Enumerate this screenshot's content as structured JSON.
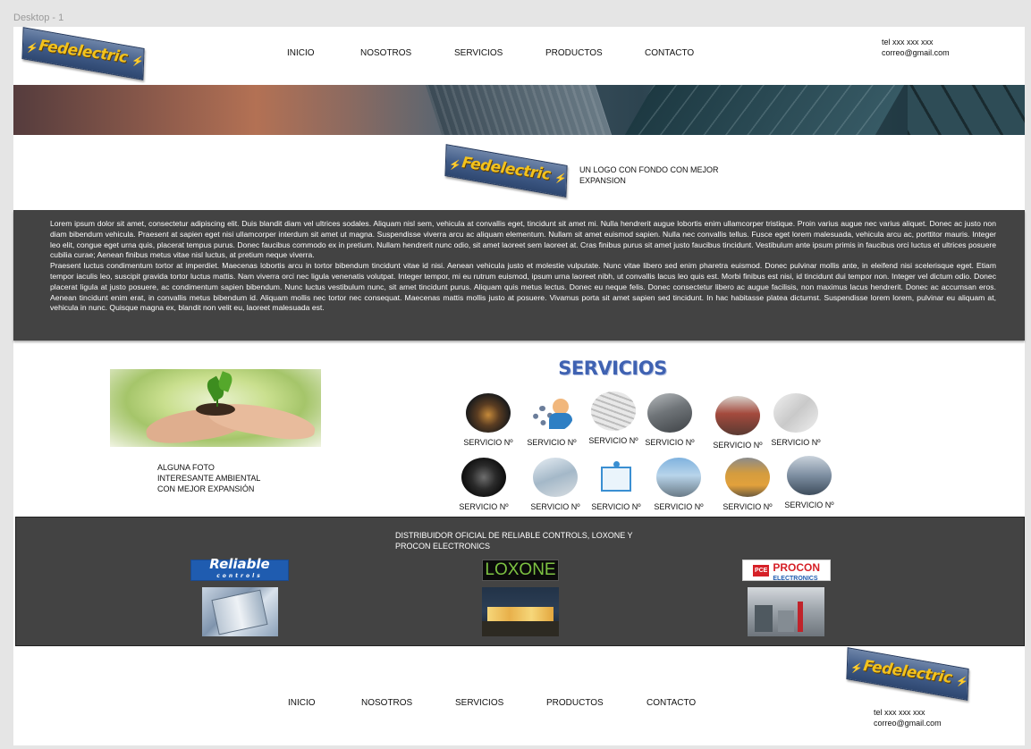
{
  "canvas": {
    "frame_label": "Desktop - 1"
  },
  "brand": {
    "logo_text": "Fedelectric"
  },
  "header": {
    "nav": [
      "INICIO",
      "NOSOTROS",
      "SERVICIOS",
      "PRODUCTOS",
      "CONTACTO"
    ],
    "phone": "tel xxx xxx xxx",
    "email": "correo@gmail.com"
  },
  "intro": {
    "tagline": "UN LOGO CON FONDO CON MEJOR EXPANSION"
  },
  "lorem": {
    "p1": "Lorem ipsum dolor sit amet, consectetur adipiscing elit. Duis blandit diam vel ultrices sodales. Aliquam nisl sem, vehicula at convallis eget, tincidunt sit amet mi. Nulla hendrerit augue lobortis enim ullamcorper tristique. Proin varius augue nec varius aliquet. Donec ac justo non diam bibendum vehicula. Praesent at sapien eget nisi ullamcorper interdum sit amet ut magna. Suspendisse viverra arcu ac aliquam elementum. Nullam sit amet euismod sapien. Nulla nec convallis tellus. Fusce eget lorem malesuada, vehicula arcu ac, porttitor mauris. Integer leo elit, congue eget urna quis, placerat tempus purus. Donec faucibus commodo ex in pretium. Nullam hendrerit nunc odio, sit amet laoreet sem laoreet at. Cras finibus purus sit amet justo faucibus tincidunt. Vestibulum ante ipsum primis in faucibus orci luctus et ultrices posuere cubilia curae; Aenean finibus metus vitae nisl luctus, at pretium neque viverra.",
    "p2": "Praesent luctus condimentum tortor at imperdiet. Maecenas lobortis arcu in tortor bibendum tincidunt vitae id nisi. Aenean vehicula justo et molestie vulputate. Nunc vitae libero sed enim pharetra euismod. Donec pulvinar mollis ante, in eleifend nisi scelerisque eget. Etiam tempor iaculis leo, suscipit gravida tortor luctus mattis. Nam viverra orci nec ligula venenatis volutpat. Integer tempor, mi eu rutrum euismod, ipsum urna laoreet nibh, ut convallis lacus leo quis est. Morbi finibus est nisi, id tincidunt dui tempor non. Integer vel dictum odio. Donec placerat ligula at justo posuere, ac condimentum sapien bibendum. Nunc luctus vestibulum nunc, sit amet tincidunt purus. Aliquam quis metus lectus. Donec eu neque felis. Donec consectetur libero ac augue facilisis, non maximus lacus hendrerit. Donec ac accumsan eros. Aenean tincidunt enim erat, in convallis metus bibendum id. Aliquam mollis nec tortor nec consequat. Maecenas mattis mollis justo at posuere. Vivamus porta sit amet sapien sed tincidunt. In hac habitasse platea dictumst. Suspendisse lorem lorem, pulvinar eu aliquam at, vehicula in nunc. Quisque magna ex, blandit non velit eu, laoreet malesuada est."
  },
  "eco": {
    "caption": "ALGUNA FOTO\nINTERESANTE AMBIENTAL\nCON MEJOR EXPANSIÓN"
  },
  "servicios": {
    "title": "SERVICIOS",
    "items": [
      "SERVICIO Nº",
      "SERVICIO Nº",
      "SERVICIO Nº",
      "SERVICIO Nº",
      "SERVICIO Nº",
      "SERVICIO Nº",
      "SERVICIO Nº",
      "SERVICIO Nº",
      "SERVICIO Nº",
      "SERVICIO Nº",
      "SERVICIO Nº",
      "SERVICIO Nº"
    ]
  },
  "distribuidor": {
    "title": "DISTRIBUIDOR OFICIAL DE RELIABLE CONTROLS, LOXONE Y PROCON ELECTRONICS",
    "reliable": {
      "name": "Reliable",
      "sub": "controls"
    },
    "loxone": {
      "name": "LOXONE"
    },
    "procon": {
      "badge": "PCE",
      "name": "PROCON",
      "sub": "ELECTRONICS"
    }
  },
  "colors": {
    "dark_band": "#434343",
    "accent_blue": "#3f62b2",
    "logo_yellow": "#f3c21c"
  }
}
